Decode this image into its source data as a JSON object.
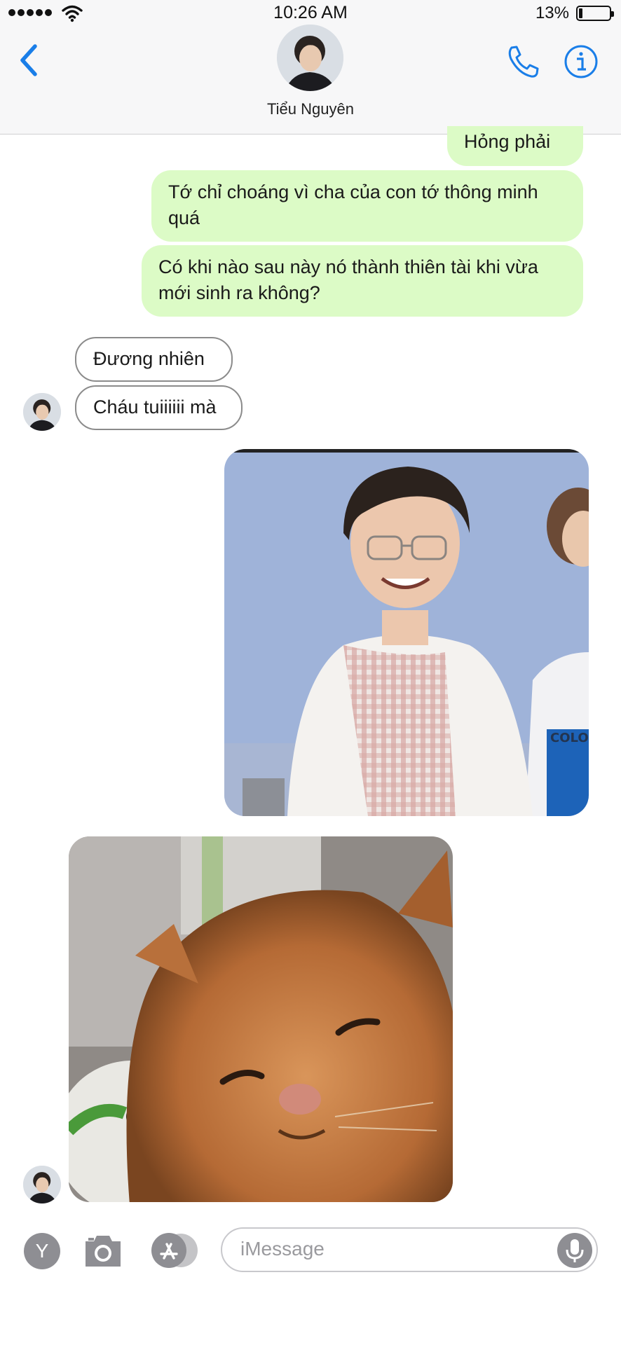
{
  "status_bar": {
    "time": "10:26 AM",
    "battery_percent": "13%",
    "battery_level": 0.13
  },
  "header": {
    "contact_name": "Tiểu Nguyên",
    "icons": [
      "back-chevron-icon",
      "phone-icon",
      "info-icon"
    ]
  },
  "messages": {
    "out": [
      "Hỏng phải",
      "Tớ chỉ choáng vì cha của con tớ thông minh quá",
      "Có khi nào sau này nó thành thiên tài khi vừa mới sinh ra không?"
    ],
    "in": [
      "Đương nhiên",
      "Cháu tuiiiiii mà"
    ]
  },
  "input_bar": {
    "placeholder": "iMessage",
    "apps_letter": "Y"
  },
  "colors": {
    "accent": "#1a7ee8",
    "outgoing_bubble": "#dcfbc6",
    "incoming_border": "#8b8b8b"
  }
}
